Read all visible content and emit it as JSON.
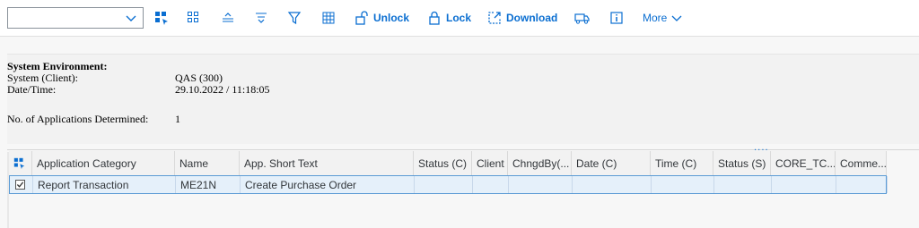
{
  "toolbar": {
    "layout_select_value": "",
    "unlock_label": "Unlock",
    "lock_label": "Lock",
    "download_label": "Download",
    "more_label": "More"
  },
  "info": {
    "heading": "System Environment:",
    "system_label": "System (Client):",
    "system_value": "QAS (300)",
    "datetime_label": "Date/Time:",
    "datetime_value": "29.10.2022 / 11:18:05",
    "apps_label": "No. of Applications Determined:",
    "apps_value": "1"
  },
  "splitter": {
    "dots": "...."
  },
  "table": {
    "columns": [
      "Application Category",
      "Name",
      "App. Short Text",
      "Status (C)",
      "Client",
      "ChngdBy(...",
      "Date (C)",
      "Time (C)",
      "Status (S)",
      "CORE_TC...",
      "Comme..."
    ],
    "rows": [
      {
        "checked": true,
        "cells": [
          "Report Transaction",
          "ME21N",
          "Create Purchase Order",
          "",
          "",
          "",
          "",
          "",
          "",
          "",
          ""
        ]
      }
    ]
  },
  "colors": {
    "accent": "#0a6ed1",
    "selected_row": "#e5f0fa",
    "selected_border": "#5b9bd5"
  }
}
